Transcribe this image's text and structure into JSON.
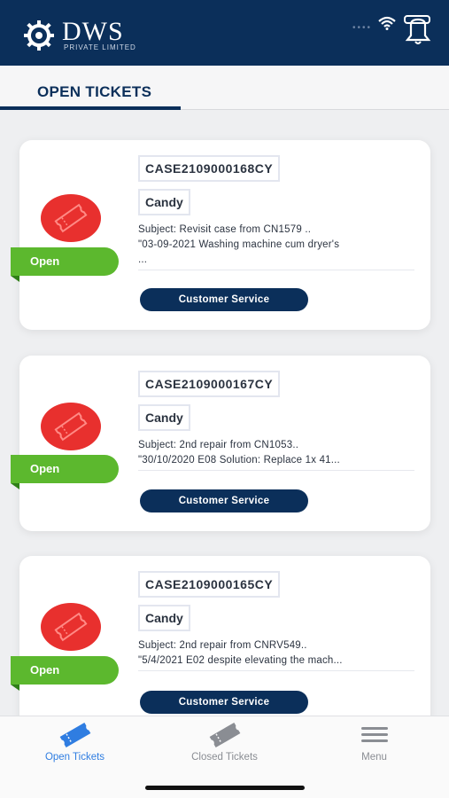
{
  "header": {
    "logo_name": "DWS",
    "logo_sub": "PRIVATE LIMITED",
    "status_dots": "••••",
    "icons": [
      "gear-logo-icon",
      "wifi-icon",
      "notification-bell-icon"
    ]
  },
  "tabs": {
    "open_label": "OPEN TICKETS"
  },
  "tickets": [
    {
      "case": "CASE2109000168CY",
      "brand": "Candy",
      "subject_line1": "Subject: Revisit case from CN1579 ..",
      "subject_line2": "\"03-09-2021 Washing machine cum dryer's",
      "subject_line3": "...",
      "status": "Open",
      "action": "Customer Service"
    },
    {
      "case": "CASE2109000167CY",
      "brand": "Candy",
      "subject_line1": "Subject: 2nd repair from CN1053..",
      "subject_line2": "\"30/10/2020 E08 Solution: Replace 1x 41...",
      "status": "Open",
      "action": "Customer Service"
    },
    {
      "case": "CASE2109000165CY",
      "brand": "Candy",
      "subject_line1": "Subject: 2nd repair from CNRV549..",
      "subject_line2": "\"5/4/2021 E02 despite elevating the mach...",
      "status": "Open",
      "action": "Customer Service"
    }
  ],
  "bottom_nav": {
    "items": [
      {
        "label": "Open Tickets",
        "icon": "ticket-icon",
        "active": true
      },
      {
        "label": "Closed Tickets",
        "icon": "ticket-icon",
        "active": false
      },
      {
        "label": "Menu",
        "icon": "hamburger-menu-icon",
        "active": false
      }
    ]
  },
  "colors": {
    "primary": "#0b2f5a",
    "ticket_red": "#e8302e",
    "open_green": "#5cb82e",
    "active_blue": "#2f7de1",
    "inactive_gray": "#8a8d93"
  }
}
